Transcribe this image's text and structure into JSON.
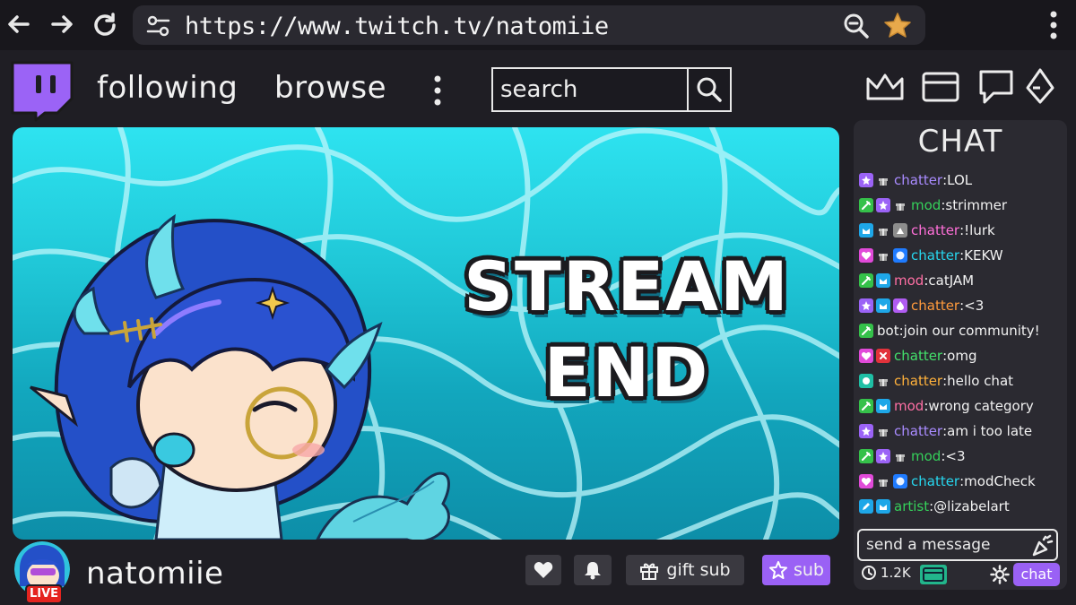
{
  "browser": {
    "url": "https://www.twitch.tv/natomiie",
    "icons": [
      "back-arrow-icon",
      "forward-arrow-icon",
      "reload-icon",
      "site-settings-icon",
      "zoom-out-icon",
      "bookmark-star-icon",
      "browser-menu-icon"
    ]
  },
  "header": {
    "following_label": "following",
    "browse_label": "browse",
    "search_placeholder": "search",
    "icons": [
      "crown-icon",
      "inbox-icon",
      "whispers-icon",
      "bits-icon"
    ]
  },
  "stream": {
    "title_line1": "STREAM",
    "title_line2": "END"
  },
  "channel": {
    "name": "natomiie",
    "live_label": "LIVE",
    "gift_label": "gift sub",
    "sub_label": "sub"
  },
  "chat": {
    "title": "CHAT",
    "messages": [
      {
        "badges": [
          "star",
          "gift"
        ],
        "user": "chatter",
        "color": "#a98bff",
        "text": "LOL"
      },
      {
        "badges": [
          "mod",
          "star",
          "gift"
        ],
        "user": "mod",
        "color": "#35d15a",
        "text": "strimmer"
      },
      {
        "badges": [
          "prime",
          "gift",
          "gray"
        ],
        "user": "chatter",
        "color": "#ff6fd8",
        "text": "!lurk"
      },
      {
        "badges": [
          "heart",
          "gift",
          "hex"
        ],
        "user": "chatter",
        "color": "#27d6ee",
        "text": "KEKW"
      },
      {
        "badges": [
          "mod",
          "prime"
        ],
        "user": "mod",
        "color": "#ff6fa4",
        "text": "catJAM"
      },
      {
        "badges": [
          "star",
          "prime",
          "drop"
        ],
        "user": "chatter",
        "color": "#ff9a3c",
        "text": "<3"
      },
      {
        "badges": [
          "mod"
        ],
        "user": "bot",
        "color": "#f2f2f2",
        "text": "join our community!"
      },
      {
        "badges": [
          "heart",
          "red"
        ],
        "user": "chatter",
        "color": "#43e06b",
        "text": "omg"
      },
      {
        "badges": [
          "teal",
          "gift"
        ],
        "user": "chatter",
        "color": "#ffb13b",
        "text": "hello chat"
      },
      {
        "badges": [
          "mod",
          "prime"
        ],
        "user": "mod",
        "color": "#ff6fa4",
        "text": "wrong category"
      },
      {
        "badges": [
          "star",
          "gift"
        ],
        "user": "chatter",
        "color": "#a98bff",
        "text": "am i too late"
      },
      {
        "badges": [
          "mod",
          "star",
          "gift"
        ],
        "user": "mod",
        "color": "#35d15a",
        "text": "<3"
      },
      {
        "badges": [
          "heart",
          "gift",
          "hex"
        ],
        "user": "chatter",
        "color": "#27d6ee",
        "text": "modCheck"
      },
      {
        "badges": [
          "pencil",
          "prime"
        ],
        "user": "artist",
        "color": "#35d15a",
        "text": "@lizabelart"
      }
    ],
    "input_placeholder": "send a message",
    "viewer_count": "1.2K",
    "chat_button": "chat"
  }
}
